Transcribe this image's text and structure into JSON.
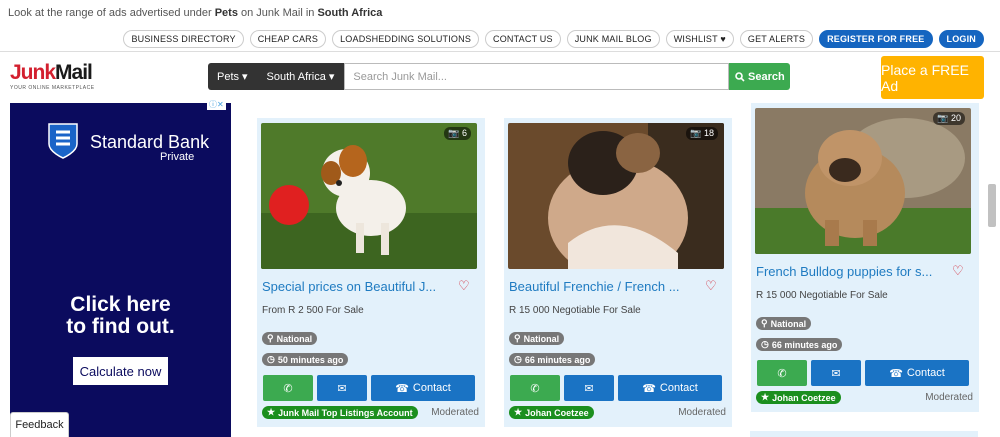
{
  "topline": {
    "prefix": "Look at the range of ads advertised under ",
    "category": "Pets",
    "middle": " on Junk Mail in ",
    "region": "South Africa"
  },
  "nav": [
    "BUSINESS DIRECTORY",
    "CHEAP CARS",
    "LOADSHEDDING SOLUTIONS",
    "CONTACT US",
    "JUNK MAIL BLOG",
    "WISHLIST ♥",
    "GET ALERTS"
  ],
  "auth": {
    "register": "REGISTER FOR FREE",
    "login": "LOGIN"
  },
  "logo": {
    "junk": "Junk",
    "mail": "Mail",
    "tagline": "YOUR ONLINE MARKETPLACE"
  },
  "search": {
    "category": "Pets",
    "region": "South Africa",
    "placeholder": "Search Junk Mail...",
    "button": "Search"
  },
  "place_ad": "Place a FREE Ad",
  "banner": {
    "brand": "Standard Bank",
    "sub": "Private",
    "cta_line1": "Click here",
    "cta_line2": "to find out.",
    "button": "Calculate now",
    "adchoices": "ⓘ✕"
  },
  "feedback": "Feedback",
  "listings": [
    {
      "photos": "6",
      "title": "Special prices on Beautiful J...",
      "price": "From R 2 500 For Sale",
      "location": "National",
      "age": "50 minutes ago",
      "contact": "Contact",
      "seller": "Junk Mail Top Listings Account",
      "status": "Moderated"
    },
    {
      "photos": "18",
      "title": "Beautiful Frenchie / French ...",
      "price": "R 15 000 Negotiable For Sale",
      "location": "National",
      "age": "66 minutes ago",
      "contact": "Contact",
      "seller": "Johan Coetzee",
      "status": "Moderated"
    },
    {
      "photos": "20",
      "title": "French Bulldog puppies for s...",
      "price": "R 15 000 Negotiable For Sale",
      "location": "National",
      "age": "66 minutes ago",
      "contact": "Contact",
      "seller": "Johan Coetzee",
      "status": "Moderated"
    }
  ],
  "colors": {
    "brand_red": "#d3202f",
    "blue": "#1565c0",
    "green": "#3caa50",
    "orange": "#ffb300",
    "card_bg": "#e3f1fb"
  }
}
